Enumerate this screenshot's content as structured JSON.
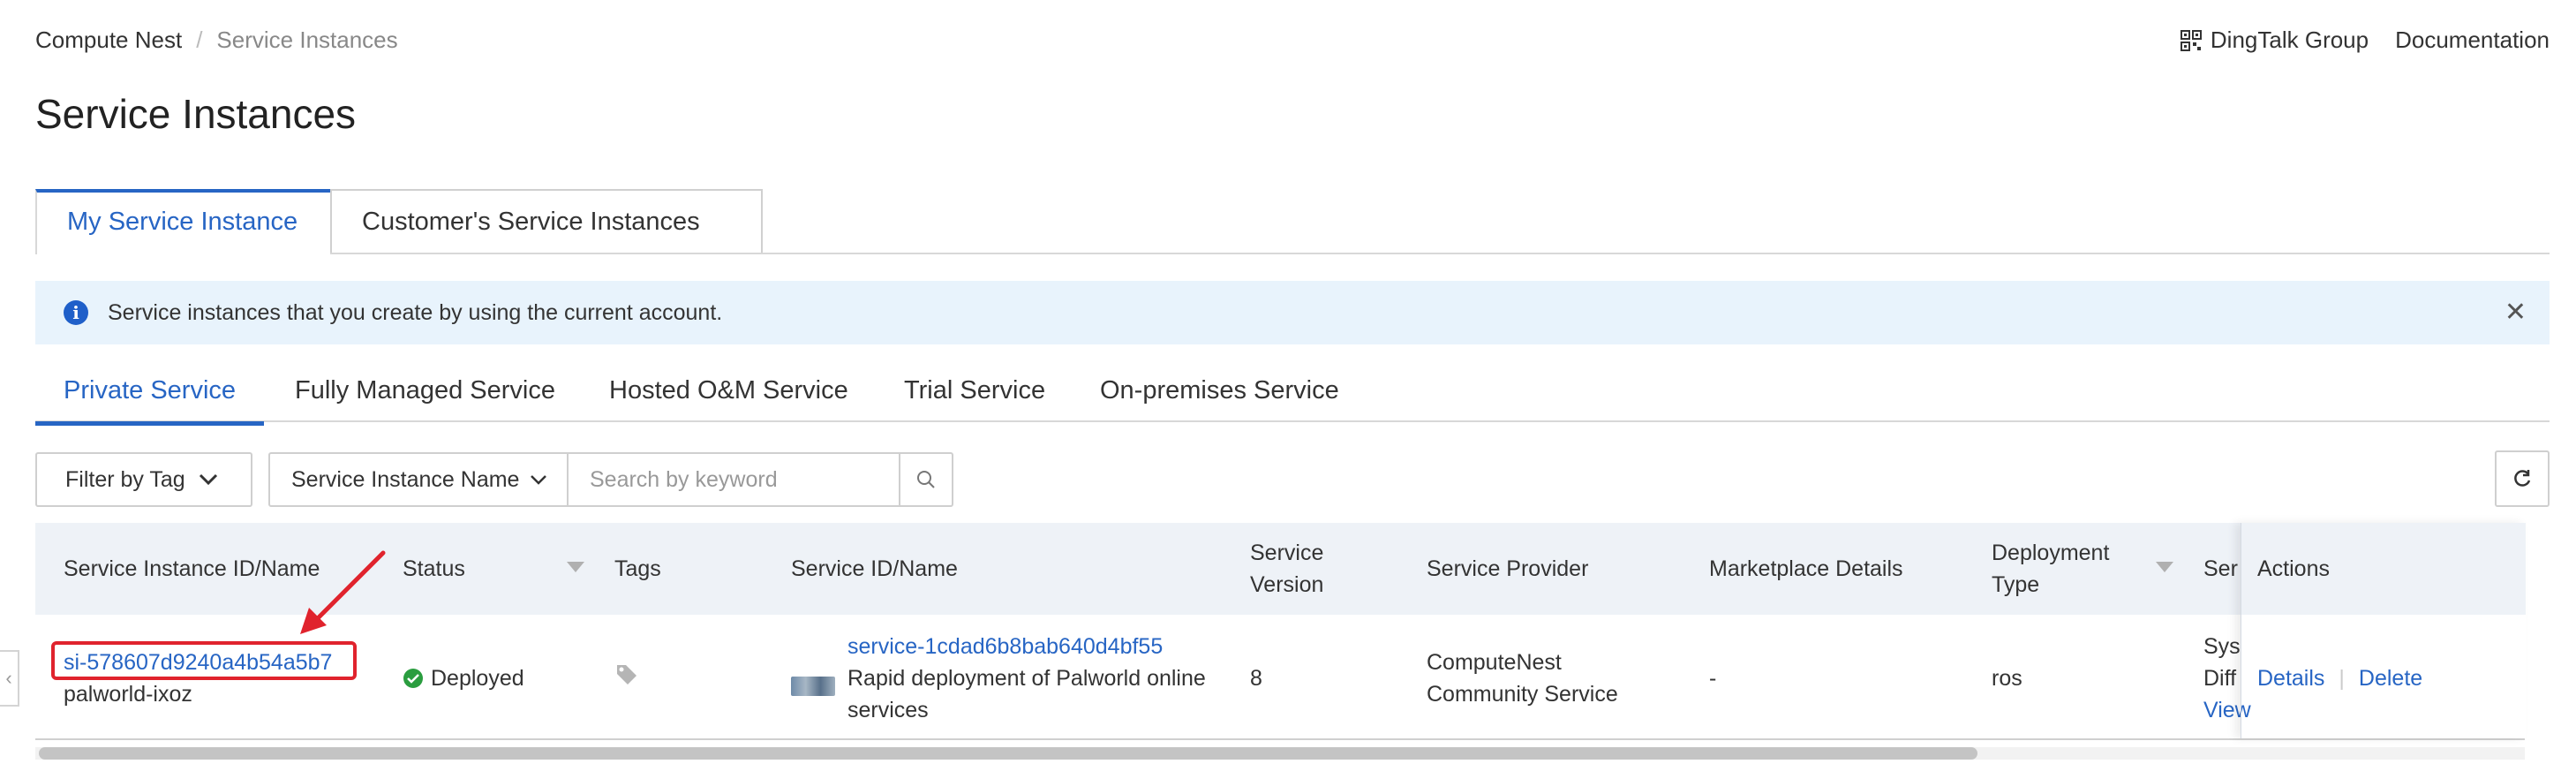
{
  "breadcrumb": {
    "root": "Compute Nest",
    "separator": "/",
    "current": "Service Instances"
  },
  "top_links": {
    "dingtalk": "DingTalk Group",
    "documentation": "Documentation"
  },
  "page_title": "Service Instances",
  "main_tabs": [
    {
      "label": "My Service Instance",
      "active": true
    },
    {
      "label": "Customer's Service Instances",
      "active": false
    }
  ],
  "banner": {
    "icon": "info-icon",
    "text": "Service instances that you create by using the current account."
  },
  "sub_tabs": [
    {
      "label": "Private Service",
      "active": true
    },
    {
      "label": "Fully Managed Service",
      "active": false
    },
    {
      "label": "Hosted O&M Service",
      "active": false
    },
    {
      "label": "Trial Service",
      "active": false
    },
    {
      "label": "On-premises Service",
      "active": false
    }
  ],
  "filters": {
    "filter_by_tag": "Filter by Tag",
    "search_field": "Service Instance Name",
    "search_placeholder": "Search by keyword"
  },
  "table": {
    "headers": {
      "instance": "Service Instance ID/Name",
      "status": "Status",
      "tags": "Tags",
      "service": "Service ID/Name",
      "version_line1": "Service",
      "version_line2": "Version",
      "provider": "Service Provider",
      "marketplace": "Marketplace Details",
      "deployment_line1": "Deployment",
      "deployment_line2": "Type",
      "service_truncated": "Ser",
      "actions": "Actions"
    },
    "rows": [
      {
        "instance_id": "si-578607d9240a4b54a5b7",
        "instance_name": "palworld-ixoz",
        "status": "Deployed",
        "service_id": "service-1cdad6b8bab640d4bf55",
        "service_name_line1": "Rapid deployment of Palworld online",
        "service_name_line2": "services",
        "version": "8",
        "provider_line1": "ComputeNest",
        "provider_line2": "Community Service",
        "marketplace": "-",
        "deployment": "ros",
        "truncated_line1": "Sys",
        "truncated_line2": "Diff",
        "truncated_line3": "View",
        "action_details": "Details",
        "action_delete": "Delete"
      }
    ]
  },
  "colors": {
    "accent": "#2765c4",
    "success": "#2a9d3f",
    "highlight": "#e0232d",
    "banner_bg": "#e8f3fc"
  }
}
